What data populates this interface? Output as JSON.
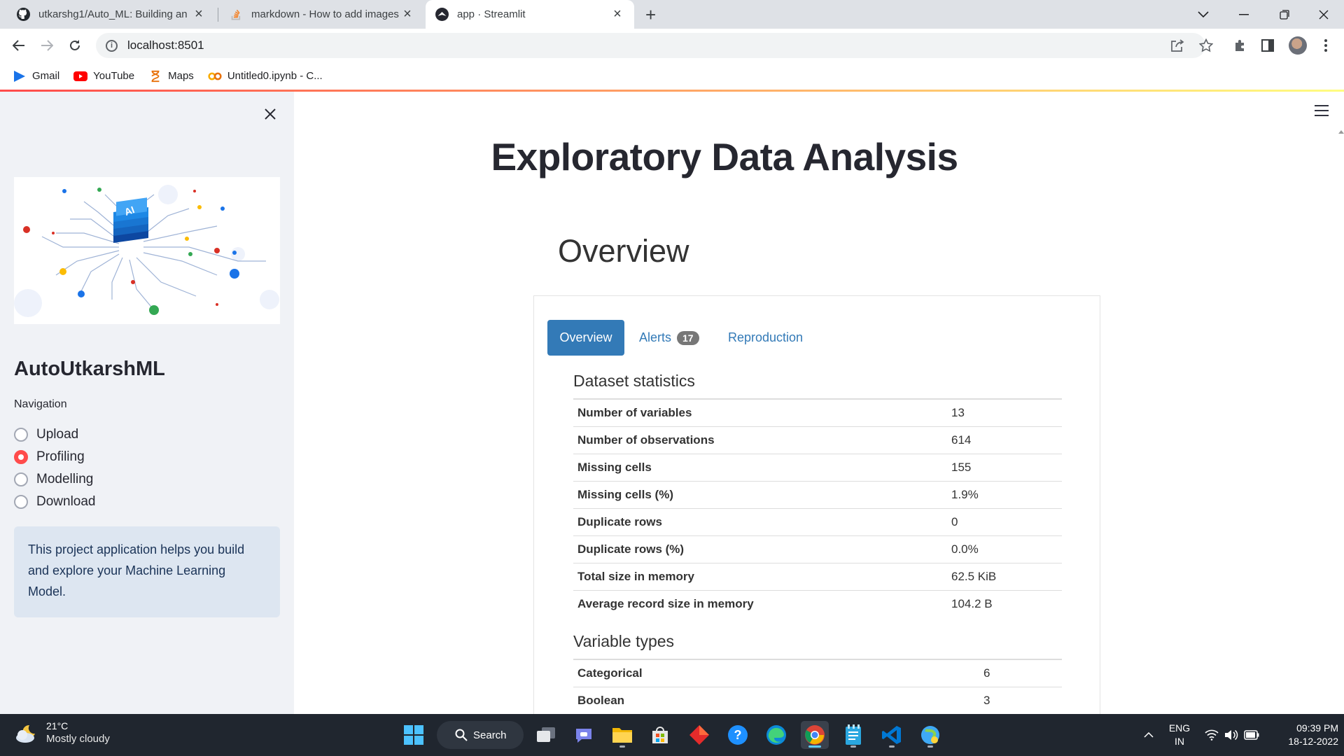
{
  "browser": {
    "tabs": [
      {
        "title": "utkarshg1/Auto_ML: Building an",
        "icon": "github-icon"
      },
      {
        "title": "markdown - How to add images",
        "icon": "stackoverflow-icon"
      },
      {
        "title": "app · Streamlit",
        "icon": "streamlit-icon"
      }
    ],
    "url": "localhost:8501",
    "bookmarks": [
      {
        "label": "Gmail",
        "icon": "gmail-icon"
      },
      {
        "label": "YouTube",
        "icon": "youtube-icon"
      },
      {
        "label": "Maps",
        "icon": "maps-icon"
      },
      {
        "label": "Untitled0.ipynb - C...",
        "icon": "colab-icon"
      }
    ]
  },
  "sidebar": {
    "title": "AutoUtkarshML",
    "nav_label": "Navigation",
    "nav_options": [
      "Upload",
      "Profiling",
      "Modelling",
      "Download"
    ],
    "selected": "Profiling",
    "info": "This project application helps you build and explore your Machine Learning Model.",
    "image_text": "AI"
  },
  "main": {
    "title": "Exploratory Data Analysis",
    "overview_heading": "Overview",
    "report_tabs": {
      "overview": "Overview",
      "alerts": "Alerts",
      "alerts_count": "17",
      "reproduction": "Reproduction"
    },
    "dataset_statistics_title": "Dataset statistics",
    "dataset_statistics": [
      {
        "label": "Number of variables",
        "value": "13"
      },
      {
        "label": "Number of observations",
        "value": "614"
      },
      {
        "label": "Missing cells",
        "value": "155"
      },
      {
        "label": "Missing cells (%)",
        "value": "1.9%"
      },
      {
        "label": "Duplicate rows",
        "value": "0"
      },
      {
        "label": "Duplicate rows (%)",
        "value": "0.0%"
      },
      {
        "label": "Total size in memory",
        "value": "62.5 KiB"
      },
      {
        "label": "Average record size in memory",
        "value": "104.2 B"
      }
    ],
    "variable_types_title": "Variable types",
    "variable_types": [
      {
        "label": "Categorical",
        "value": "6"
      },
      {
        "label": "Boolean",
        "value": "3"
      }
    ]
  },
  "taskbar": {
    "weather_temp": "21°C",
    "weather_desc": "Mostly cloudy",
    "search_label": "Search",
    "lang_1": "ENG",
    "lang_2": "IN",
    "time": "09:39 PM",
    "date": "18-12-2022"
  },
  "colors": {
    "streamlit_red": "#ff4b4b",
    "report_blue": "#337ab7",
    "sidebar_bg": "#f0f2f6",
    "info_bg": "#dde6f1"
  }
}
